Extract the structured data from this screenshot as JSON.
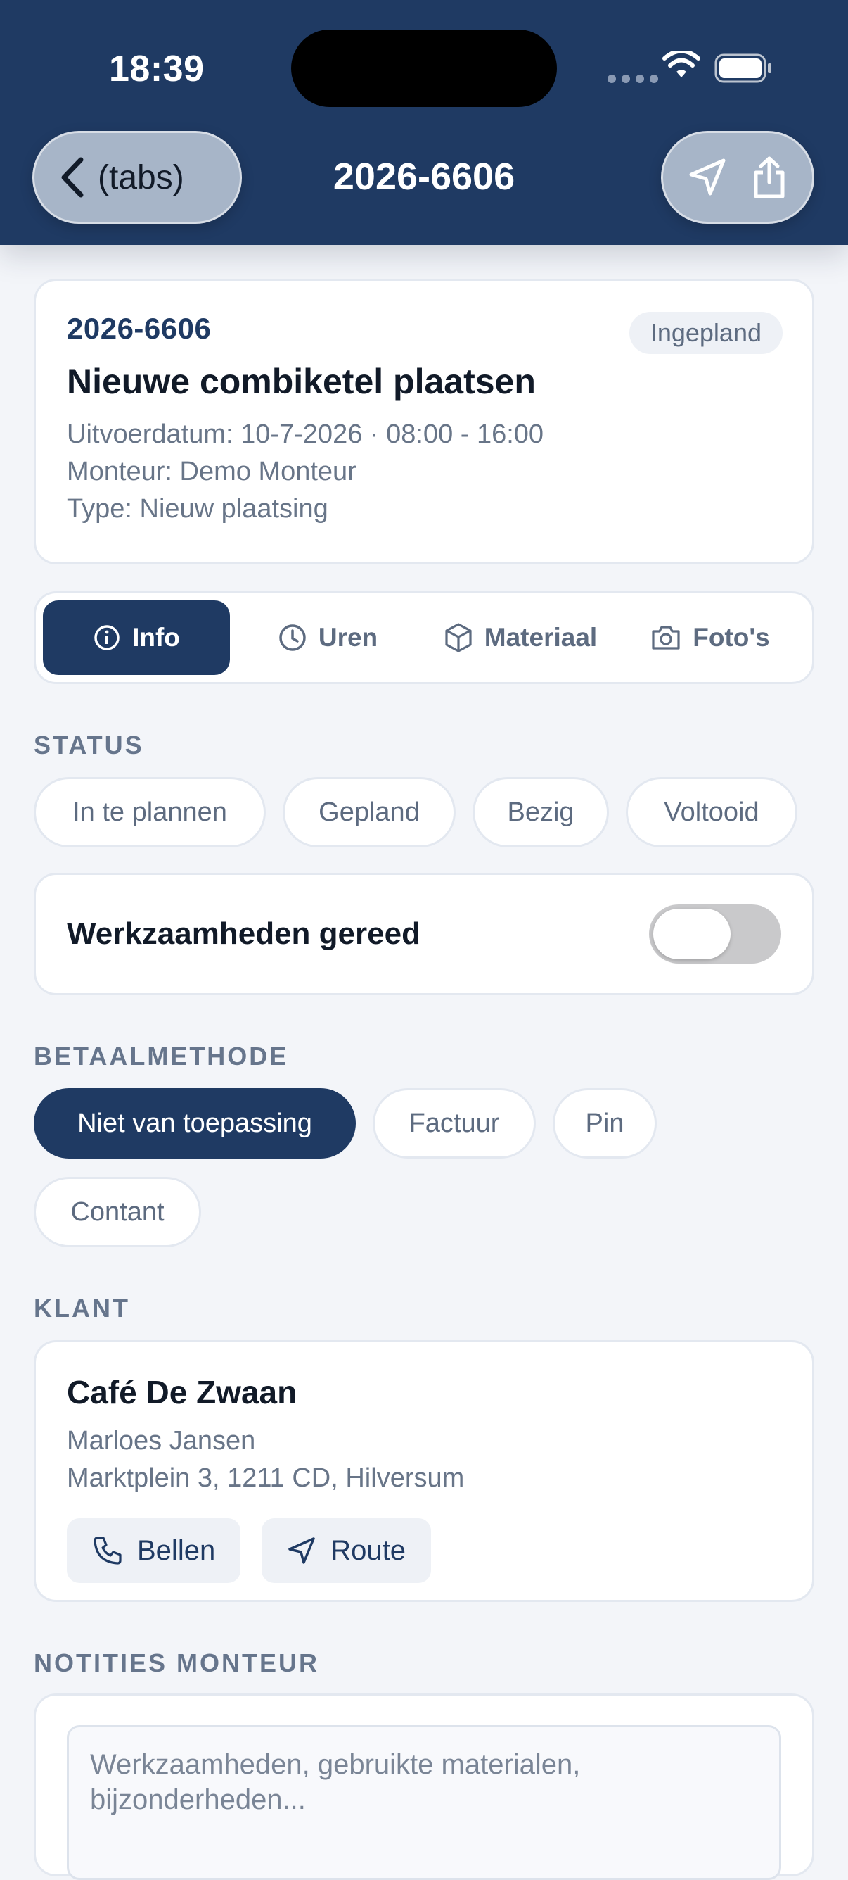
{
  "status_bar": {
    "time": "18:39"
  },
  "nav": {
    "back_label": "(tabs)",
    "title": "2026-6606"
  },
  "job": {
    "number": "2026-6606",
    "status_badge": "Ingepland",
    "title": "Nieuwe combiketel plaatsen",
    "execution_date": "Uitvoerdatum: 10-7-2026 · 08:00 - 16:00",
    "technician": "Monteur: Demo Monteur",
    "type": "Type: Nieuw plaatsing"
  },
  "tabs": [
    {
      "label": "Info",
      "icon": "info-icon",
      "active": true
    },
    {
      "label": "Uren",
      "icon": "clock-icon",
      "active": false
    },
    {
      "label": "Materiaal",
      "icon": "box-icon",
      "active": false
    },
    {
      "label": "Foto's",
      "icon": "camera-icon",
      "active": false
    }
  ],
  "status_section": {
    "label": "STATUS",
    "options": [
      "In te plannen",
      "Gepland",
      "Bezig",
      "Voltooid"
    ]
  },
  "work_done": {
    "label": "Werkzaamheden gereed",
    "enabled": false
  },
  "payment_section": {
    "label": "BETAALMETHODE",
    "options": [
      "Niet van toepassing",
      "Factuur",
      "Pin",
      "Contant"
    ],
    "selected": "Niet van toepassing"
  },
  "client_section": {
    "label": "KLANT",
    "name": "Café De Zwaan",
    "contact": "Marloes Jansen",
    "address": "Marktplein 3, 1211 CD, Hilversum",
    "call_label": "Bellen",
    "route_label": "Route"
  },
  "notes_section": {
    "label": "NOTITIES MONTEUR",
    "placeholder": "Werkzaamheden, gebruikte materialen, bijzonderheden..."
  },
  "colors": {
    "primary": "#1f3a63",
    "background": "#f3f5f9",
    "muted": "#687588"
  }
}
